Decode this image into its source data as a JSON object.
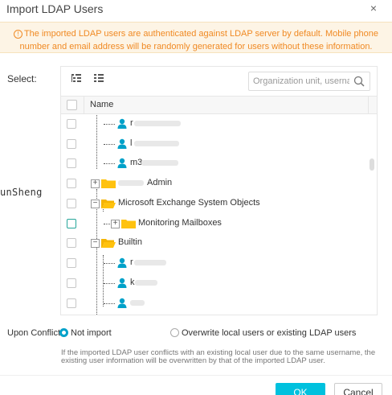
{
  "dialog": {
    "title": "Import LDAP Users",
    "close_glyph": "×"
  },
  "warning": {
    "icon": "!",
    "text": "The imported LDAP users are authenticated against LDAP server by default. Mobile phone number and email address will be randomly generated for users without these information."
  },
  "form": {
    "select_label": "Select:",
    "side_text": "unSheng",
    "conflict_label": "Upon Conflict:"
  },
  "panel": {
    "search_placeholder": "Organization unit, username",
    "column_name": "Name"
  },
  "tree": {
    "row_user1_visible": "r",
    "row_user2_visible": "l",
    "row_user3_visible": "m3",
    "row_admin_suffix": "Admin",
    "row_exchange": "Microsoft Exchange System Objects",
    "row_monitoring": "Monitoring Mailboxes",
    "row_builtin": "Builtin",
    "row_user4_visible": "r",
    "row_user5_visible": "k"
  },
  "conflict": {
    "option1": "Not import",
    "option2": "Overwrite local users or existing LDAP users",
    "selected": "option1"
  },
  "note": "If the imported LDAP user conflicts with an existing local user due to the same username, the existing user information will be overwritten by that of the imported LDAP user.",
  "buttons": {
    "ok": "OK",
    "cancel": "Cancel"
  },
  "colors": {
    "accent": "#00c1de",
    "warning_text": "#f08a24",
    "warning_bg": "#fdf4e5",
    "user_icon": "#00a1c9",
    "folder": "#ffc20e"
  },
  "icons": {
    "expand_all": "expand-all-icon",
    "collapse_all": "collapse-all-icon",
    "search": "search-icon",
    "folder": "folder-icon",
    "user": "user-icon"
  }
}
